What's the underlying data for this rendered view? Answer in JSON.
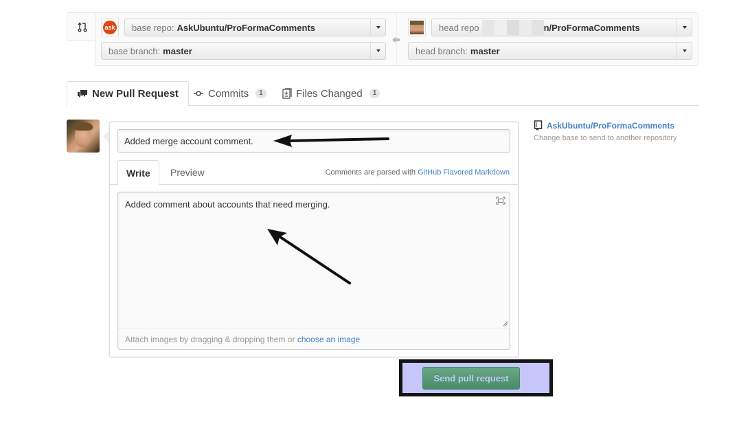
{
  "range_editor": {
    "base_repo": {
      "label": "base repo:",
      "value": "AskUbuntu/ProFormaComments",
      "avatar_text": "ask"
    },
    "base_branch": {
      "label": "base branch:",
      "value": "master"
    },
    "head_repo": {
      "label": "head repo",
      "value": "n/ProFormaComments"
    },
    "head_branch": {
      "label": "head branch:",
      "value": "master"
    }
  },
  "tabs": [
    {
      "label": "New Pull Request",
      "icon": "discussion-icon",
      "selected": true
    },
    {
      "label": "Commits",
      "icon": "commit-icon",
      "count": "1"
    },
    {
      "label": "Files Changed",
      "icon": "diff-file-icon",
      "count": "1"
    }
  ],
  "composer": {
    "title_value": "Added merge account comment.",
    "tabs": [
      {
        "label": "Write",
        "selected": true
      },
      {
        "label": "Preview"
      }
    ],
    "markdown_hint_prefix": "Comments are parsed with",
    "markdown_hint_link": "GitHub Flavored Markdown",
    "body_value": "Added comment about accounts that need merging.",
    "attach_hint_prefix": "Attach images by dragging & dropping them or",
    "attach_hint_link": "choose an image"
  },
  "sidebar": {
    "repo_link": "AskUbuntu/ProFormaComments",
    "hint": "Change base to send to another repository"
  },
  "submit": {
    "label": "Send pull request"
  },
  "colors": {
    "link": "#4183c4",
    "button_green": "#4b8b69",
    "highlight_fill": "#c6c6fb",
    "highlight_border": "#141414",
    "ask_ubuntu_orange": "#dd4814"
  }
}
